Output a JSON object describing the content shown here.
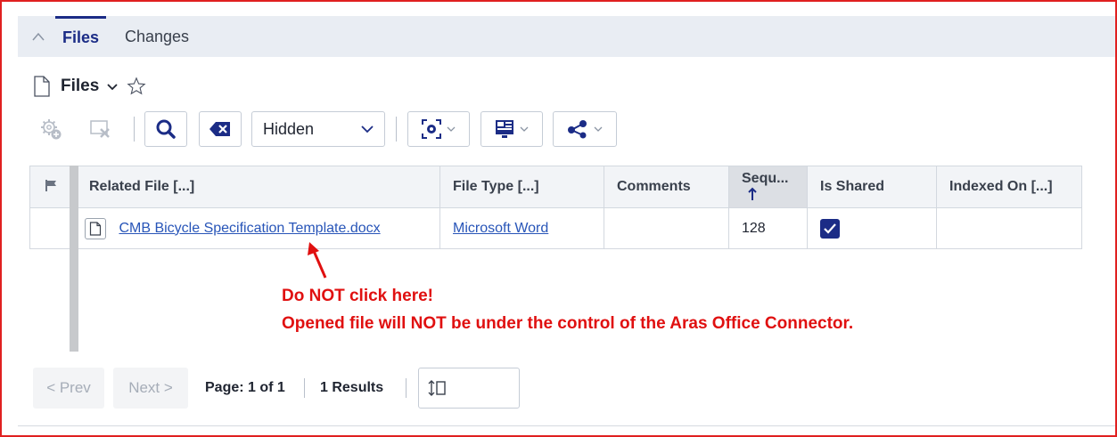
{
  "tabs": {
    "collapse_icon": "chevron-up-icon",
    "items": [
      {
        "label": "Files",
        "active": true
      },
      {
        "label": "Changes",
        "active": false
      }
    ]
  },
  "header": {
    "title": "Files",
    "icons": [
      "document-icon",
      "chevron-down-icon",
      "star-icon"
    ]
  },
  "toolbar": {
    "icons": [
      "add-gear-icon",
      "remove-icon",
      "search-icon",
      "clear-backspace-icon",
      "view-icon",
      "layout-icon",
      "share-icon"
    ],
    "filter_dropdown": {
      "selected": "Hidden"
    }
  },
  "grid": {
    "columns": [
      {
        "key": "flag",
        "label": ""
      },
      {
        "key": "related_file",
        "label": "Related File [...]"
      },
      {
        "key": "file_type",
        "label": "File Type [...]"
      },
      {
        "key": "comments",
        "label": "Comments"
      },
      {
        "key": "sequence",
        "label": "Sequ..."
      },
      {
        "key": "is_shared",
        "label": "Is Shared"
      },
      {
        "key": "indexed_on",
        "label": "Indexed On [...]"
      }
    ],
    "rows": [
      {
        "related_file": "CMB Bicycle Specification Template.docx",
        "file_type": "Microsoft Word",
        "comments": "",
        "sequence": "128",
        "is_shared": true,
        "indexed_on": ""
      }
    ]
  },
  "annotation": {
    "line1": "Do NOT click here!",
    "line2": "Opened file will NOT be under the control of the Aras Office Connector.",
    "color": "#e01010"
  },
  "pager": {
    "prev_label": "< Prev",
    "next_label": "Next >",
    "page_text": "Page: 1 of 1",
    "results_text": "1 Results",
    "page_size_value": ""
  },
  "colors": {
    "accent": "#1b2c86",
    "link": "#2855b8",
    "frame": "#e02020"
  }
}
